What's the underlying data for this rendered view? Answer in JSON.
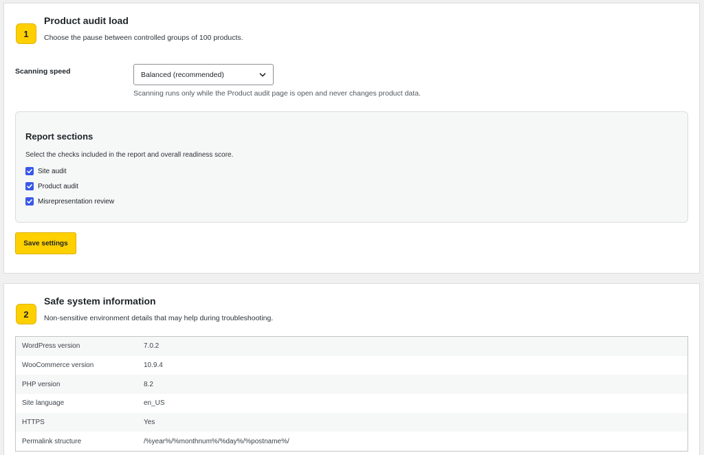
{
  "audit_load": {
    "step": "1",
    "title": "Product audit load",
    "description": "Choose the pause between controlled groups of 100 products.",
    "speed_label": "Scanning speed",
    "speed_value": "Balanced (recommended)",
    "help_text": "Scanning runs only while the Product audit page is open and never changes product data."
  },
  "report_sections": {
    "title": "Report sections",
    "description": "Select the checks included in the report and overall readiness score.",
    "options": [
      {
        "label": "Site audit",
        "checked": true
      },
      {
        "label": "Product audit",
        "checked": true
      },
      {
        "label": "Misrepresentation review",
        "checked": true
      }
    ]
  },
  "save_label": "Save settings",
  "system_info": {
    "step": "2",
    "title": "Safe system information",
    "description": "Non-sensitive environment details that may help during troubleshooting.",
    "rows": [
      {
        "key": "WordPress version",
        "value": "7.0.2"
      },
      {
        "key": "WooCommerce version",
        "value": "10.9.4"
      },
      {
        "key": "PHP version",
        "value": "8.2"
      },
      {
        "key": "Site language",
        "value": "en_US"
      },
      {
        "key": "HTTPS",
        "value": "Yes"
      },
      {
        "key": "Permalink structure",
        "value": "/%year%/%monthnum%/%day%/%postname%/"
      }
    ]
  },
  "colors": {
    "accent": "#ffd000",
    "checkbox": "#3858e9",
    "page_background": "#f0f0f1"
  }
}
